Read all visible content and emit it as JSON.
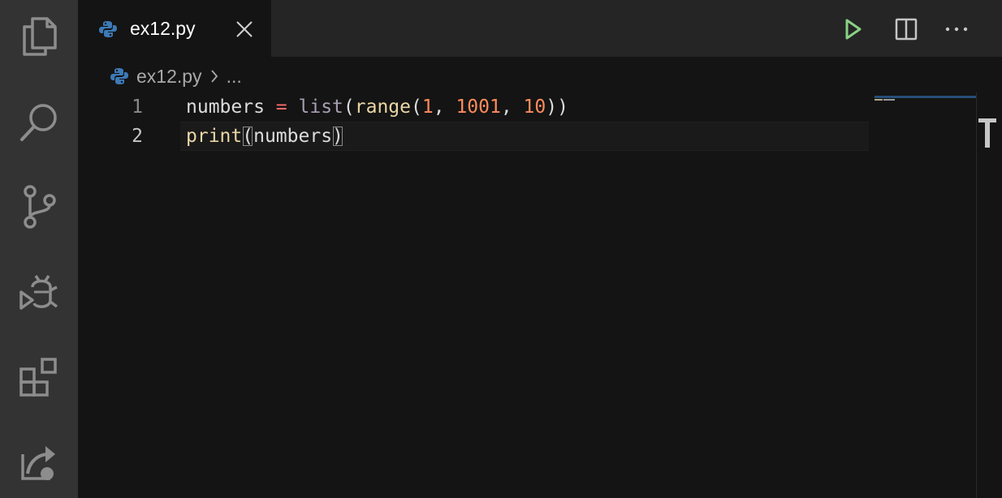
{
  "activity_bar": {
    "items": [
      {
        "name": "explorer",
        "icon": "files-icon"
      },
      {
        "name": "search",
        "icon": "search-icon"
      },
      {
        "name": "source-control",
        "icon": "source-control-icon"
      },
      {
        "name": "run-debug",
        "icon": "debug-icon"
      },
      {
        "name": "extensions",
        "icon": "extensions-icon"
      },
      {
        "name": "remote",
        "icon": "remote-explorer-icon"
      }
    ]
  },
  "tabs": [
    {
      "label": "ex12.py",
      "icon": "python-icon",
      "active": true
    }
  ],
  "editor_actions": [
    {
      "name": "run-python-file",
      "icon": "play-icon",
      "color": "#89d185"
    },
    {
      "name": "split-editor",
      "icon": "split-editor-icon"
    },
    {
      "name": "more-actions",
      "icon": "ellipsis-icon"
    }
  ],
  "breadcrumb": {
    "file": "ex12.py",
    "ellipsis": "..."
  },
  "editor": {
    "lines": [
      {
        "number": "1",
        "tokens": {
          "t1": "numbers",
          "t2": " ",
          "t3": "=",
          "t4": " ",
          "t5": "list",
          "t6": "(",
          "t7": "range",
          "t8": "(",
          "t9": "1",
          "t10": ", ",
          "t11": "1001",
          "t12": ", ",
          "t13": "10",
          "t14": "))"
        }
      },
      {
        "number": "2",
        "tokens": {
          "t1": "print",
          "t2": "(",
          "t3": "numbers",
          "t4": ")"
        }
      }
    ],
    "current_line": 2
  },
  "colors": {
    "activity_bar_bg": "#333333",
    "editor_bg": "#141414",
    "python_blue": "#3d7ab6",
    "run_green": "#89d185"
  }
}
